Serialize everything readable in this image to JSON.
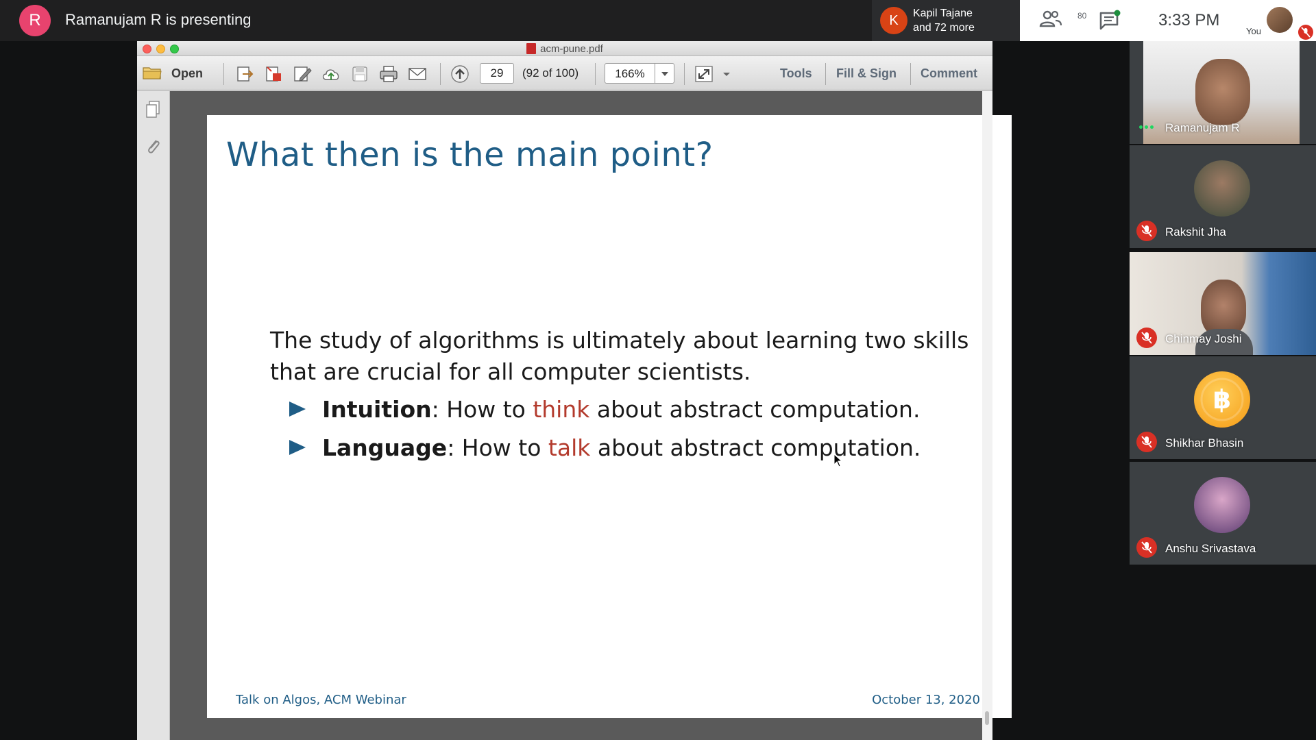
{
  "meet": {
    "presenter_initial": "R",
    "presenter_text": "Ramanujam R is presenting",
    "recent_join_initial": "K",
    "recent_join_line1": "Kapil Tajane",
    "recent_join_line2": "and 72 more",
    "participant_count": "80",
    "clock": "3:33 PM",
    "self_label": "You",
    "colors": {
      "presenter_avatar": "#e8436e",
      "join_avatar": "#d84315",
      "mic_off": "#d93025",
      "speaking_dots": "#1ed760"
    }
  },
  "pdf": {
    "title": "acm-pune.pdf",
    "toolbar": {
      "open_label": "Open",
      "page_number": "29",
      "page_count": "(92 of 100)",
      "zoom": "166%",
      "tools_label": "Tools",
      "fill_sign_label": "Fill & Sign",
      "comment_label": "Comment"
    },
    "icons": [
      "folder-icon",
      "export-icon",
      "create-pdf-icon",
      "edit-icon",
      "cloud-upload-icon",
      "save-icon",
      "print-icon",
      "mail-icon",
      "page-up-icon",
      "fit-page-icon",
      "pages-icon",
      "attachment-icon"
    ]
  },
  "slide": {
    "title": "What then is the main point?",
    "body": "The study of algorithms is ultimately about learning two skills that are crucial for all computer scientists.",
    "bullets": [
      {
        "keyword": "Intuition",
        "pre": ": How to ",
        "highlight": "think",
        "post": " about abstract computation."
      },
      {
        "keyword": "Language",
        "pre": ": How to ",
        "highlight": "talk",
        "post": " about abstract computation."
      }
    ],
    "footer_left": "Talk on Algos, ACM Webinar",
    "footer_right": "October 13, 2020",
    "colors": {
      "title": "#1f5d86",
      "highlight": "#b33a2c"
    }
  },
  "participants": [
    {
      "name": "Ramanujam R",
      "muted": false,
      "video": true
    },
    {
      "name": "Rakshit Jha",
      "muted": true,
      "video": false
    },
    {
      "name": "Chinmay Joshi",
      "muted": true,
      "video": true
    },
    {
      "name": "Shikhar Bhasin",
      "muted": true,
      "video": false
    },
    {
      "name": "Anshu Srivastava",
      "muted": true,
      "video": false
    }
  ]
}
